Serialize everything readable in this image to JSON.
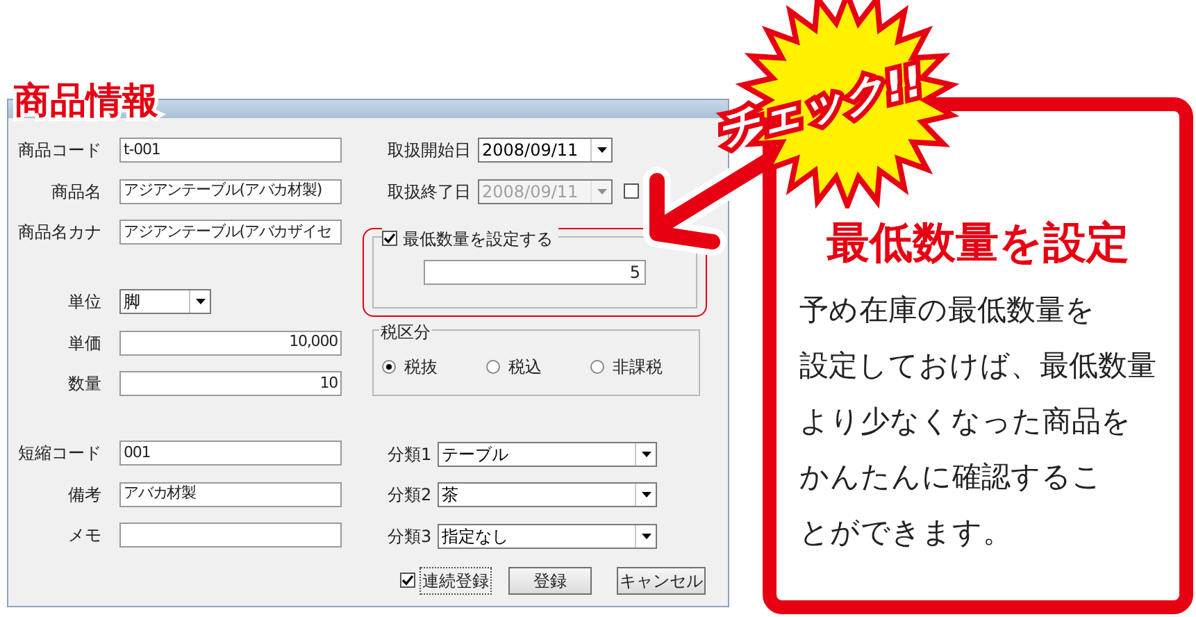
{
  "window": {
    "overlay_title": "商品情報"
  },
  "left_groups": [
    [
      {
        "label": "商品コード",
        "value": "t-001",
        "kind": "text"
      },
      {
        "label": "商品名",
        "value": "アジアンテーブル(アバカ材製)",
        "kind": "text"
      },
      {
        "label": "商品名カナ",
        "value": "アジアンテーブル(アバカザイセ",
        "kind": "text"
      }
    ],
    [
      {
        "label": "単位",
        "value": "脚",
        "kind": "select"
      },
      {
        "label": "単価",
        "value": "10,000",
        "kind": "number"
      },
      {
        "label": "数量",
        "value": "10",
        "kind": "number"
      }
    ],
    [
      {
        "label": "短縮コード",
        "value": "001",
        "kind": "text"
      },
      {
        "label": "備考",
        "value": "アバカ材製",
        "kind": "text"
      },
      {
        "label": "メモ",
        "kind": "text"
      }
    ]
  ],
  "dates": [
    {
      "label": "取扱開始日",
      "value": "2008/09/11",
      "disabled": false
    },
    {
      "label": "取扱終了日",
      "value": "2008/09/11",
      "disabled": true
    }
  ],
  "end_date_checkbox": {
    "checked": false
  },
  "min_quantity": {
    "label": "最低数量を設定する",
    "checked": true,
    "value": "5",
    "highlighted": true
  },
  "tax": {
    "title": "税区分",
    "options": [
      {
        "label": "税抜",
        "selected": true
      },
      {
        "label": "税込",
        "selected": false
      },
      {
        "label": "非課税",
        "selected": false
      }
    ]
  },
  "categories": [
    {
      "label": "分類1",
      "value": "テーブル"
    },
    {
      "label": "分類2",
      "value": "茶"
    },
    {
      "label": "分類3",
      "value": "指定なし"
    }
  ],
  "continuous": {
    "label": "連続登録",
    "checked": true
  },
  "buttons": [
    "登録",
    "キャンセル"
  ],
  "callout": {
    "badge": "チェック!!",
    "heading": "最低数量を設定",
    "body_lines": [
      "予め在庫の最低数量を",
      "設定しておけば、最低数量",
      "より少なくなった商品を",
      "かんたんに確認するこ",
      "とができます。"
    ]
  }
}
